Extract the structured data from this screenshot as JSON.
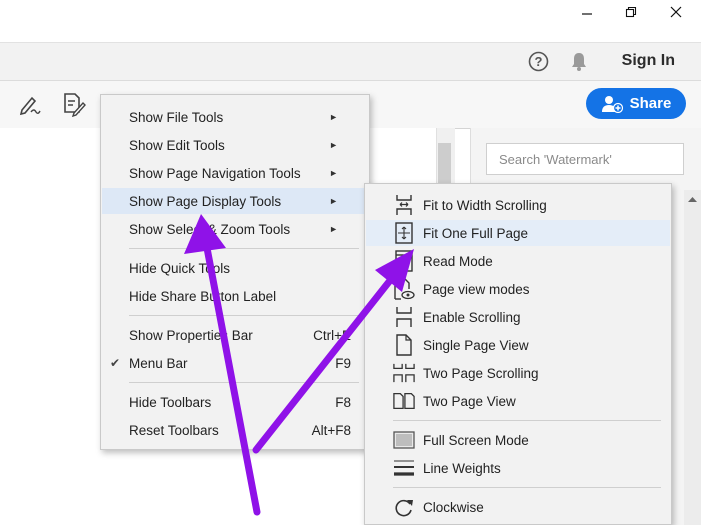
{
  "header": {
    "help_glyph": "?",
    "sign_in": "Sign In"
  },
  "toolbar": {
    "share_label": "Share"
  },
  "panel": {
    "search_placeholder": "Search 'Watermark'"
  },
  "menu1": {
    "items": [
      {
        "label": "Show File Tools",
        "arrow": "►"
      },
      {
        "label": "Show Edit Tools",
        "arrow": "►"
      },
      {
        "label": "Show Page Navigation Tools",
        "arrow": "►"
      },
      {
        "label": "Show Page Display Tools",
        "arrow": "►"
      },
      {
        "label": "Show Select & Zoom Tools",
        "arrow": "►"
      },
      {
        "label": "Hide Quick Tools"
      },
      {
        "label": "Hide Share Button Label"
      },
      {
        "label": "Show Properties Bar",
        "shortcut": "Ctrl+E"
      },
      {
        "label": "Menu Bar",
        "shortcut": "F9",
        "check": "✔"
      },
      {
        "label": "Hide Toolbars",
        "shortcut": "F8"
      },
      {
        "label": "Reset Toolbars",
        "shortcut": "Alt+F8"
      }
    ]
  },
  "menu2": {
    "items": [
      {
        "label": "Fit to Width Scrolling",
        "icon": "fit-width-scrolling-icon"
      },
      {
        "label": "Fit One Full Page",
        "icon": "fit-full-page-icon"
      },
      {
        "label": "Read Mode",
        "icon": "read-mode-icon"
      },
      {
        "label": "Page view modes",
        "icon": "page-view-modes-icon"
      },
      {
        "label": "Enable Scrolling",
        "icon": "enable-scrolling-icon"
      },
      {
        "label": "Single Page View",
        "icon": "single-page-icon"
      },
      {
        "label": "Two Page Scrolling",
        "icon": "two-page-scrolling-icon"
      },
      {
        "label": "Two Page View",
        "icon": "two-page-view-icon"
      },
      {
        "label": "Full Screen Mode",
        "icon": "full-screen-icon"
      },
      {
        "label": "Line Weights",
        "icon": "line-weights-icon"
      },
      {
        "label": "Clockwise",
        "icon": "clockwise-icon"
      }
    ]
  },
  "colors": {
    "accent": "#1473e6",
    "annotation_arrow": "#8f12e8",
    "menu_highlight": "#dde8f6"
  }
}
